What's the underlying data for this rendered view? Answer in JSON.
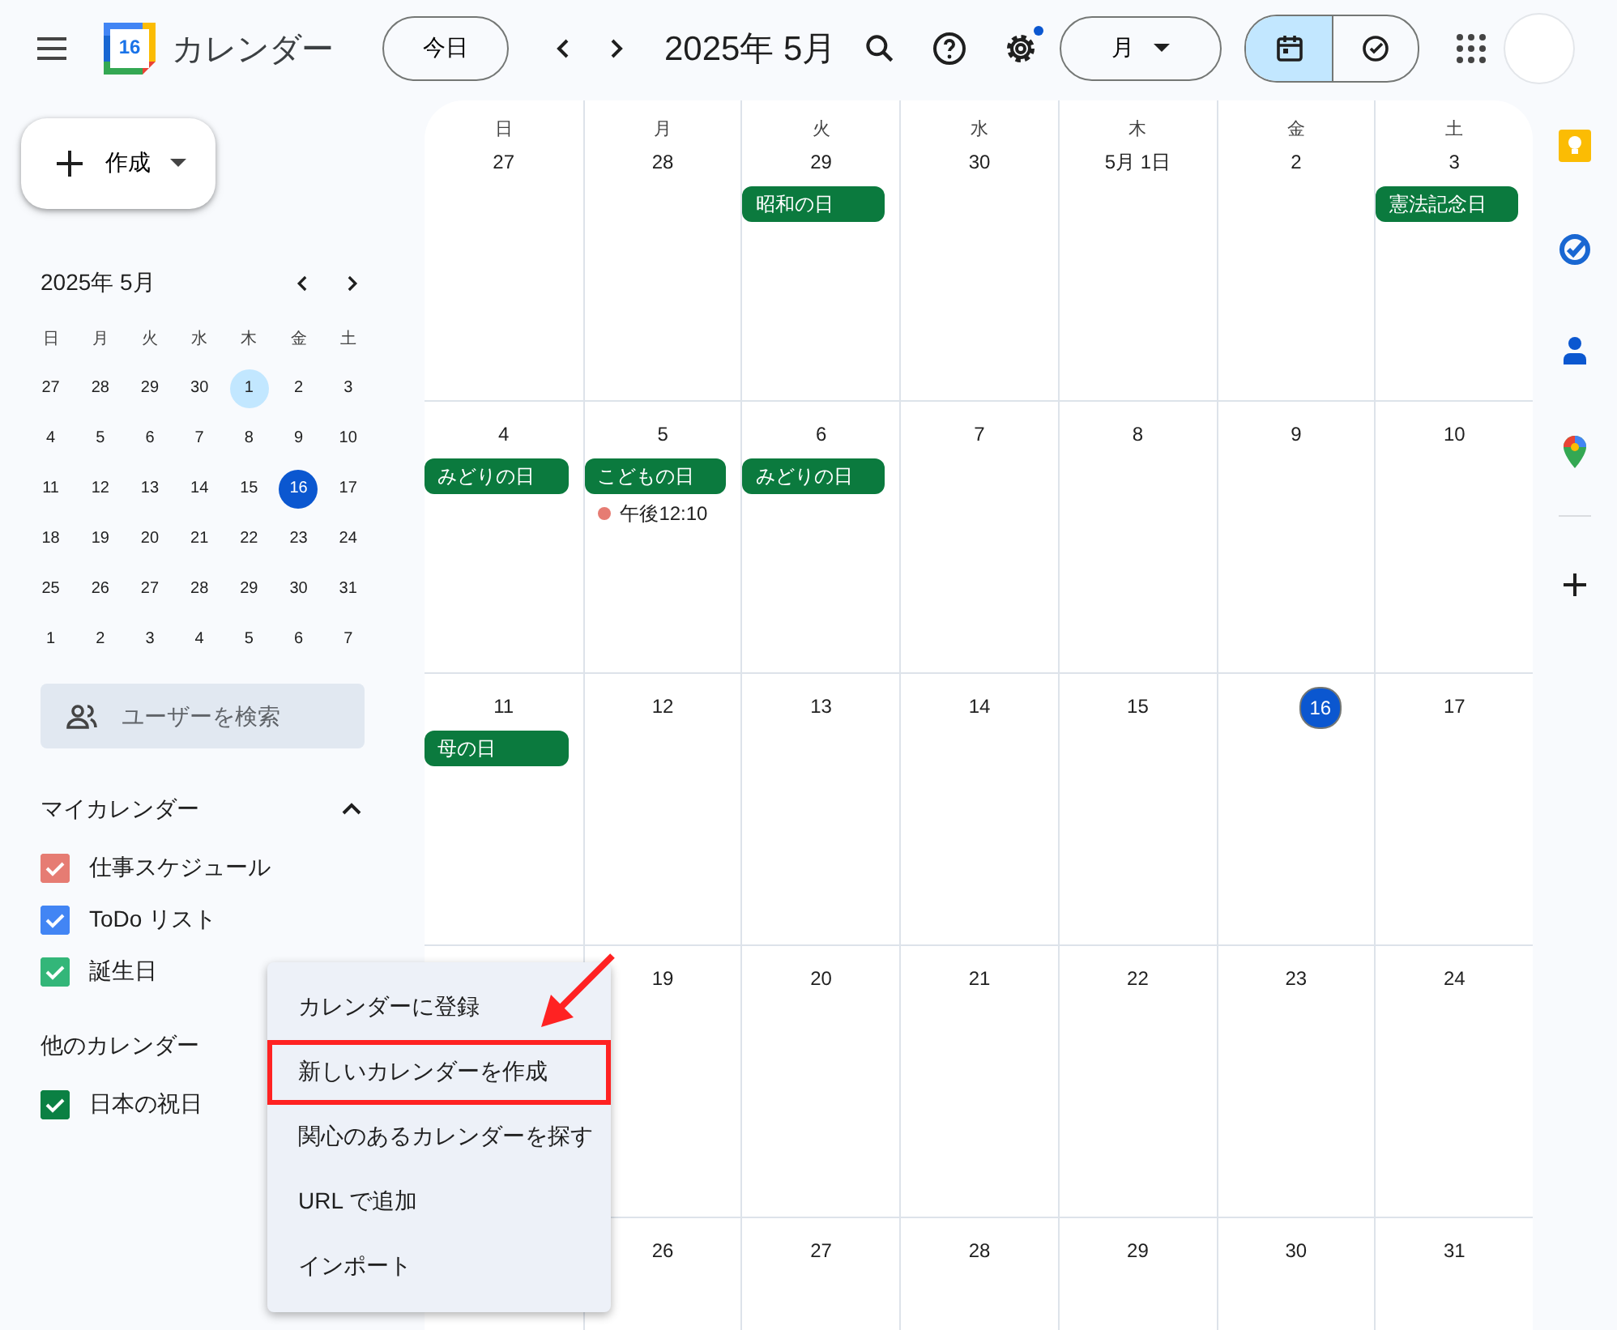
{
  "header": {
    "logo_day": "16",
    "app_title": "カレンダー",
    "today_button": "今日",
    "period_title": "2025年 5月",
    "settings_badge": true,
    "view_dropdown": "月",
    "view_toggle": [
      {
        "kind": "calendar",
        "selected": true
      },
      {
        "kind": "tasks",
        "selected": false
      }
    ]
  },
  "sidebar": {
    "create_button": "作成",
    "mini_calendar": {
      "title": "2025年 5月",
      "weekdays": [
        "日",
        "月",
        "火",
        "水",
        "木",
        "金",
        "土"
      ],
      "weeks": [
        [
          {
            "d": "27",
            "selected": false,
            "today": false
          },
          {
            "d": "28",
            "selected": false,
            "today": false
          },
          {
            "d": "29",
            "selected": false,
            "today": false
          },
          {
            "d": "30",
            "selected": false,
            "today": false
          },
          {
            "d": "1",
            "selected": true,
            "today": false
          },
          {
            "d": "2",
            "selected": false,
            "today": false
          },
          {
            "d": "3",
            "selected": false,
            "today": false
          }
        ],
        [
          {
            "d": "4",
            "selected": false,
            "today": false
          },
          {
            "d": "5",
            "selected": false,
            "today": false
          },
          {
            "d": "6",
            "selected": false,
            "today": false
          },
          {
            "d": "7",
            "selected": false,
            "today": false
          },
          {
            "d": "8",
            "selected": false,
            "today": false
          },
          {
            "d": "9",
            "selected": false,
            "today": false
          },
          {
            "d": "10",
            "selected": false,
            "today": false
          }
        ],
        [
          {
            "d": "11",
            "selected": false,
            "today": false
          },
          {
            "d": "12",
            "selected": false,
            "today": false
          },
          {
            "d": "13",
            "selected": false,
            "today": false
          },
          {
            "d": "14",
            "selected": false,
            "today": false
          },
          {
            "d": "15",
            "selected": false,
            "today": false
          },
          {
            "d": "16",
            "selected": false,
            "today": true
          },
          {
            "d": "17",
            "selected": false,
            "today": false
          }
        ],
        [
          {
            "d": "18",
            "selected": false,
            "today": false
          },
          {
            "d": "19",
            "selected": false,
            "today": false
          },
          {
            "d": "20",
            "selected": false,
            "today": false
          },
          {
            "d": "21",
            "selected": false,
            "today": false
          },
          {
            "d": "22",
            "selected": false,
            "today": false
          },
          {
            "d": "23",
            "selected": false,
            "today": false
          },
          {
            "d": "24",
            "selected": false,
            "today": false
          }
        ],
        [
          {
            "d": "25",
            "selected": false,
            "today": false
          },
          {
            "d": "26",
            "selected": false,
            "today": false
          },
          {
            "d": "27",
            "selected": false,
            "today": false
          },
          {
            "d": "28",
            "selected": false,
            "today": false
          },
          {
            "d": "29",
            "selected": false,
            "today": false
          },
          {
            "d": "30",
            "selected": false,
            "today": false
          },
          {
            "d": "31",
            "selected": false,
            "today": false
          }
        ],
        [
          {
            "d": "1",
            "selected": false,
            "today": false
          },
          {
            "d": "2",
            "selected": false,
            "today": false
          },
          {
            "d": "3",
            "selected": false,
            "today": false
          },
          {
            "d": "4",
            "selected": false,
            "today": false
          },
          {
            "d": "5",
            "selected": false,
            "today": false
          },
          {
            "d": "6",
            "selected": false,
            "today": false
          },
          {
            "d": "7",
            "selected": false,
            "today": false
          }
        ]
      ]
    },
    "people_search": {
      "placeholder": "ユーザーを検索"
    },
    "my_calendars": {
      "title": "マイカレンダー",
      "expanded": true,
      "items": [
        {
          "label": "仕事スケジュール",
          "checked": true,
          "color": "#e67c73"
        },
        {
          "label": "ToDo リスト",
          "checked": true,
          "color": "#4285f4"
        },
        {
          "label": "誕生日",
          "checked": true,
          "color": "#33b679"
        }
      ]
    },
    "other_calendars": {
      "title": "他のカレンダー",
      "items": [
        {
          "label": "日本の祝日",
          "checked": true,
          "color": "#0b8043"
        }
      ]
    }
  },
  "month_grid": {
    "weekdays": [
      "日",
      "月",
      "火",
      "水",
      "木",
      "金",
      "土"
    ],
    "weeks": [
      [
        {
          "date": "27",
          "today": false
        },
        {
          "date": "28",
          "today": false
        },
        {
          "date": "29",
          "today": false,
          "events": [
            {
              "kind": "allday",
              "title": "昭和の日",
              "color": "#0b7a3e"
            }
          ]
        },
        {
          "date": "30",
          "today": false
        },
        {
          "date": "5月 1日",
          "today": false
        },
        {
          "date": "2",
          "today": false
        },
        {
          "date": "3",
          "today": false,
          "events": [
            {
              "kind": "allday",
              "title": "憲法記念日",
              "color": "#0b7a3e"
            }
          ]
        }
      ],
      [
        {
          "date": "4",
          "today": false,
          "events": [
            {
              "kind": "allday",
              "title": "みどりの日",
              "color": "#0b7a3e"
            }
          ]
        },
        {
          "date": "5",
          "today": false,
          "events": [
            {
              "kind": "allday",
              "title": "こどもの日",
              "color": "#0b7a3e"
            },
            {
              "kind": "timed",
              "title": "午後12:10",
              "color": "#e67c73"
            }
          ]
        },
        {
          "date": "6",
          "today": false,
          "events": [
            {
              "kind": "allday",
              "title": "みどりの日",
              "color": "#0b7a3e"
            }
          ]
        },
        {
          "date": "7",
          "today": false
        },
        {
          "date": "8",
          "today": false
        },
        {
          "date": "9",
          "today": false
        },
        {
          "date": "10",
          "today": false
        }
      ],
      [
        {
          "date": "11",
          "today": false,
          "events": [
            {
              "kind": "allday",
              "title": "母の日",
              "color": "#0b7a3e"
            }
          ]
        },
        {
          "date": "12",
          "today": false
        },
        {
          "date": "13",
          "today": false
        },
        {
          "date": "14",
          "today": false
        },
        {
          "date": "15",
          "today": false
        },
        {
          "date": "16",
          "today": true
        },
        {
          "date": "17",
          "today": false
        }
      ],
      [
        {
          "date": "19",
          "today": false
        },
        {
          "date": "20",
          "today": false
        },
        {
          "date": "21",
          "today": false
        },
        {
          "date": "22",
          "today": false
        },
        {
          "date": "23",
          "today": false
        },
        {
          "date": "24",
          "today": false
        }
      ],
      [
        {
          "date": "26",
          "today": false
        },
        {
          "date": "27",
          "today": false
        },
        {
          "date": "28",
          "today": false
        },
        {
          "date": "29",
          "today": false
        },
        {
          "date": "30",
          "today": false
        },
        {
          "date": "31",
          "today": false
        }
      ]
    ]
  },
  "side_panel": [
    {
      "kind": "keep"
    },
    {
      "kind": "tasks"
    },
    {
      "kind": "contacts"
    },
    {
      "kind": "maps"
    },
    {
      "kind": "add"
    }
  ],
  "context_menu": {
    "items": [
      {
        "label": "カレンダーに登録",
        "highlighted": false
      },
      {
        "label": "新しいカレンダーを作成",
        "highlighted": true
      },
      {
        "label": "関心のあるカレンダーを探す",
        "highlighted": false
      },
      {
        "label": "URL で追加",
        "highlighted": false
      },
      {
        "label": "インポート",
        "highlighted": false
      }
    ]
  },
  "annotation_arrow": true
}
